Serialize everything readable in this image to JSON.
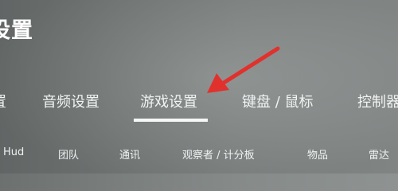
{
  "page": {
    "title": "设置"
  },
  "main_tabs": [
    {
      "label": "置"
    },
    {
      "label": "音频设置"
    },
    {
      "label": "游戏设置"
    },
    {
      "label": "键盘 / 鼠标"
    },
    {
      "label": "控制器"
    }
  ],
  "selected_main_tab": "游戏设置",
  "sub_tabs": [
    {
      "label": "Hud"
    },
    {
      "label": "团队"
    },
    {
      "label": "通讯"
    },
    {
      "label": "观察者 / 计分板"
    },
    {
      "label": "物品"
    },
    {
      "label": "雷达"
    }
  ],
  "annotation": {
    "arrow_color": "#e1312d"
  }
}
